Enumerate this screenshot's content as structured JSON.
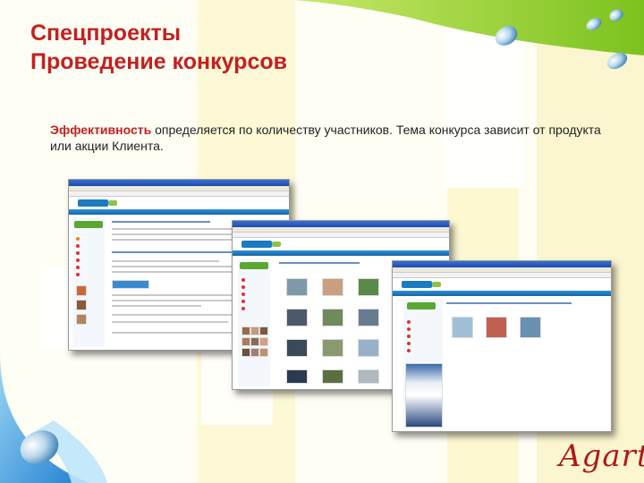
{
  "slide": {
    "title_line1": "Спецпроекты",
    "title_line2": "Проведение конкурсов",
    "description_strong": "Эффективность",
    "description_rest": " определяется по количеству участников. Тема конкурса зависит от продукта или акции Клиента.",
    "brand": "Agarty"
  },
  "colors": {
    "title": "#c42020",
    "accent_green": "#8cc63f",
    "site_blue": "#1a7bc0"
  },
  "screenshots": [
    {
      "name": "contest-page-screenshot"
    },
    {
      "name": "photo-gallery-screenshot"
    },
    {
      "name": "contest-entries-screenshot"
    }
  ]
}
